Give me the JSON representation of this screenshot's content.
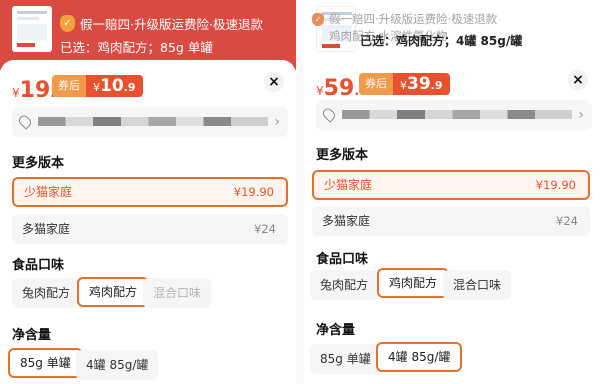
{
  "left": {
    "header": {
      "guarantee": "假一赔四·升级版运费险·极速退款",
      "selected": "已选：鸡肉配方；85g 单罐"
    },
    "price": {
      "currency": "¥",
      "int": "19",
      "dec": ".9"
    },
    "coupon": {
      "tag": "券后",
      "currency": "¥",
      "int": "10",
      "dec": ".9"
    },
    "sections": {
      "versions": {
        "title": "更多版本",
        "items": [
          {
            "label": "少猫家庭",
            "price": "¥19.90",
            "selected": true
          },
          {
            "label": "多猫家庭",
            "price": "¥24",
            "selected": false
          }
        ]
      },
      "flavor": {
        "title": "食品口味",
        "items": [
          {
            "label": "兔肉配方"
          },
          {
            "label": "鸡肉配方"
          },
          {
            "label": "混合口味"
          }
        ]
      },
      "net": {
        "title": "净含量",
        "items": [
          {
            "label": "85g 单罐"
          },
          {
            "label": "4罐 85g/罐"
          }
        ]
      }
    }
  },
  "right": {
    "header": {
      "guarantee": "假一赔四·升级版运费险·极速退款",
      "subline": "鸡肉配方·水溶性氯化物",
      "selected": "已选：鸡肉配方；4罐 85g/罐"
    },
    "price": {
      "currency": "¥",
      "int": "59",
      "dec": ".9"
    },
    "coupon": {
      "tag": "券后",
      "currency": "¥",
      "int": "39",
      "dec": ".9"
    },
    "sections": {
      "versions": {
        "title": "更多版本",
        "items": [
          {
            "label": "少猫家庭",
            "price": "¥19.90"
          },
          {
            "label": "多猫家庭",
            "price": "¥24"
          }
        ]
      },
      "flavor": {
        "title": "食品口味",
        "items": [
          {
            "label": "兔肉配方"
          },
          {
            "label": "鸡肉配方"
          },
          {
            "label": "混合口味"
          }
        ]
      },
      "net": {
        "title": "净含量",
        "items": [
          {
            "label": "85g 单罐"
          },
          {
            "label": "4罐 85g/罐"
          }
        ]
      }
    }
  },
  "icons": {
    "close": "×",
    "chevron": "›"
  },
  "colors": {
    "accent": "#e8502e",
    "coupon_tag": "#f09a4a",
    "header_red": "#d94a43"
  }
}
